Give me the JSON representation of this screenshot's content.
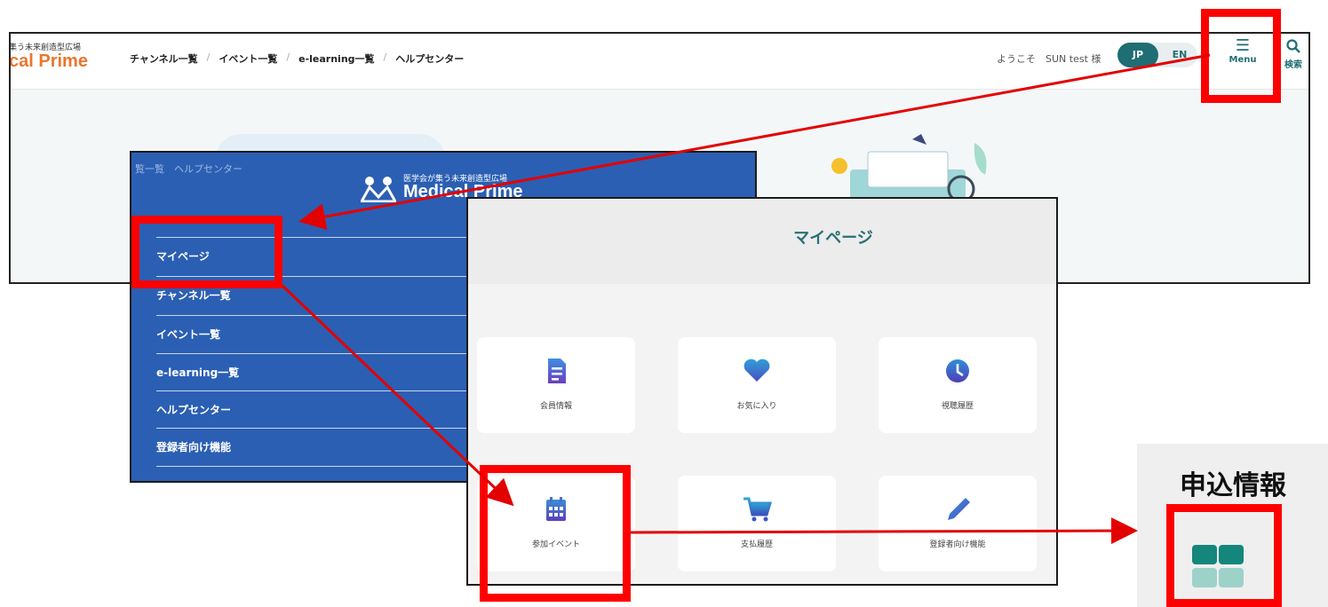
{
  "site": {
    "logo_tagline": "集う未来創造型広場",
    "logo_name": "cal Prime",
    "nav": [
      "チャンネル一覧",
      "イベント一覧",
      "e-learning一覧",
      "ヘルプセンター"
    ],
    "welcome": "ようこそ　SUN test 様",
    "lang_jp": "JP",
    "lang_en": "EN",
    "menu_label": "Menu",
    "search_label": "検索"
  },
  "drawer": {
    "breadcrumb": "覧一覧　ヘルプセンター",
    "logo_tagline": "医学会が集う未来創造型広場",
    "logo_name": "Medical Prime",
    "items": [
      "マイページ",
      "チャンネル一覧",
      "イベント一覧",
      "e-learning一覧",
      "ヘルプセンター",
      "登録者向け機能"
    ]
  },
  "mypage": {
    "title": "マイページ",
    "cards": [
      {
        "label": "会員情報",
        "icon": "document-icon"
      },
      {
        "label": "お気に入り",
        "icon": "heart-icon"
      },
      {
        "label": "視聴履歴",
        "icon": "clock-icon"
      },
      {
        "label": "参加イベント",
        "icon": "calendar-icon"
      },
      {
        "label": "支払履歴",
        "icon": "cart-icon"
      },
      {
        "label": "登録者向け機能",
        "icon": "pencil-icon"
      }
    ]
  },
  "snippet": {
    "title": "申込情報",
    "icon": "grid-icon"
  },
  "colors": {
    "accent": "#1f6e73",
    "drawer": "#2b5fb3",
    "highlight": "#ff0000",
    "arrow": "#e30000"
  }
}
